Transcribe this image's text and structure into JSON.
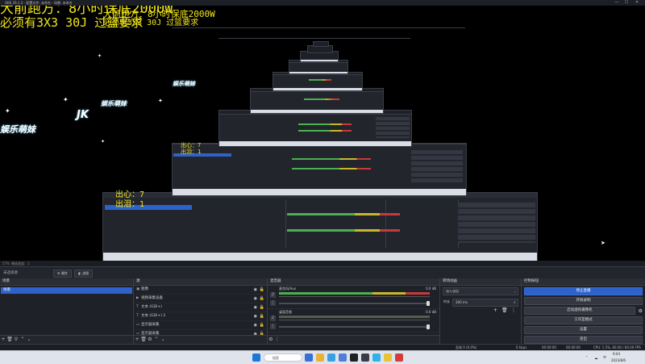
{
  "window": {
    "title": "OBS 29.1.3 - 配置文件: 未命名 - 场景: 未命名",
    "controls": {
      "minimize": "—",
      "maximize": "☐",
      "close": "✕"
    }
  },
  "overlay": {
    "line1": "大前跑方：8小时保底2000W",
    "line2": "必须有3X3 30J 过篮要求",
    "line1_small": "大前跑方：8小时保底2000W",
    "line2_small": "必须有3X3 30J 过篮要求",
    "counter_out": "出心：7",
    "counter_tear": "出泪：1",
    "brand_text": "娱乐萌妹",
    "brand_mark": "JK"
  },
  "midbar": {
    "left_a": "57%",
    "left_b": "播放速度：1"
  },
  "source_toolbar": {
    "label": "未选择源",
    "properties": "属性",
    "filters": "滤镜"
  },
  "scenes": {
    "title": "场景",
    "items": [
      "场景"
    ]
  },
  "sources": {
    "title": "源",
    "items": [
      {
        "icon": "image-icon",
        "label": "图像"
      },
      {
        "icon": "video-capture-icon",
        "label": "视频采集设备"
      },
      {
        "icon": "text-icon",
        "label": "文本 (GDI+)"
      },
      {
        "icon": "text-icon",
        "label": "文本 (GDI+) 2"
      },
      {
        "icon": "display-capture-icon",
        "label": "显示器采集"
      },
      {
        "icon": "display-capture-icon",
        "label": "显示器采集"
      }
    ]
  },
  "mixer": {
    "title": "混音器",
    "channels": [
      {
        "name": "麦克风/Aux",
        "db": "0.0 dB"
      },
      {
        "name": "桌面音频",
        "db": "0.0 dB"
      }
    ]
  },
  "transitions": {
    "title": "转场动画",
    "type": "淡入淡出",
    "duration_label": "时长",
    "duration_value": "300 ms"
  },
  "controls": {
    "title": "控制按钮",
    "buttons": [
      "停止直播",
      "开始录制",
      "启动虚拟摄像机",
      "工作室模式",
      "设置",
      "退出"
    ]
  },
  "statusbar": {
    "dropped": "丢帧 0 (0.0%)",
    "bitrate": "0 kbps",
    "rec_time": "00:00:00",
    "live_time": "00:00:00",
    "cpu": "CPU: 1.5%, 60.00 / 60.00 FPS"
  },
  "taskbar": {
    "search_placeholder": "搜索",
    "tray_lang": "中",
    "time": "9:04",
    "date": "2023/8/6"
  },
  "colors": {
    "accent": "#2e61c9",
    "overlay_text": "#f0e51a",
    "panel": "#1f2129"
  }
}
